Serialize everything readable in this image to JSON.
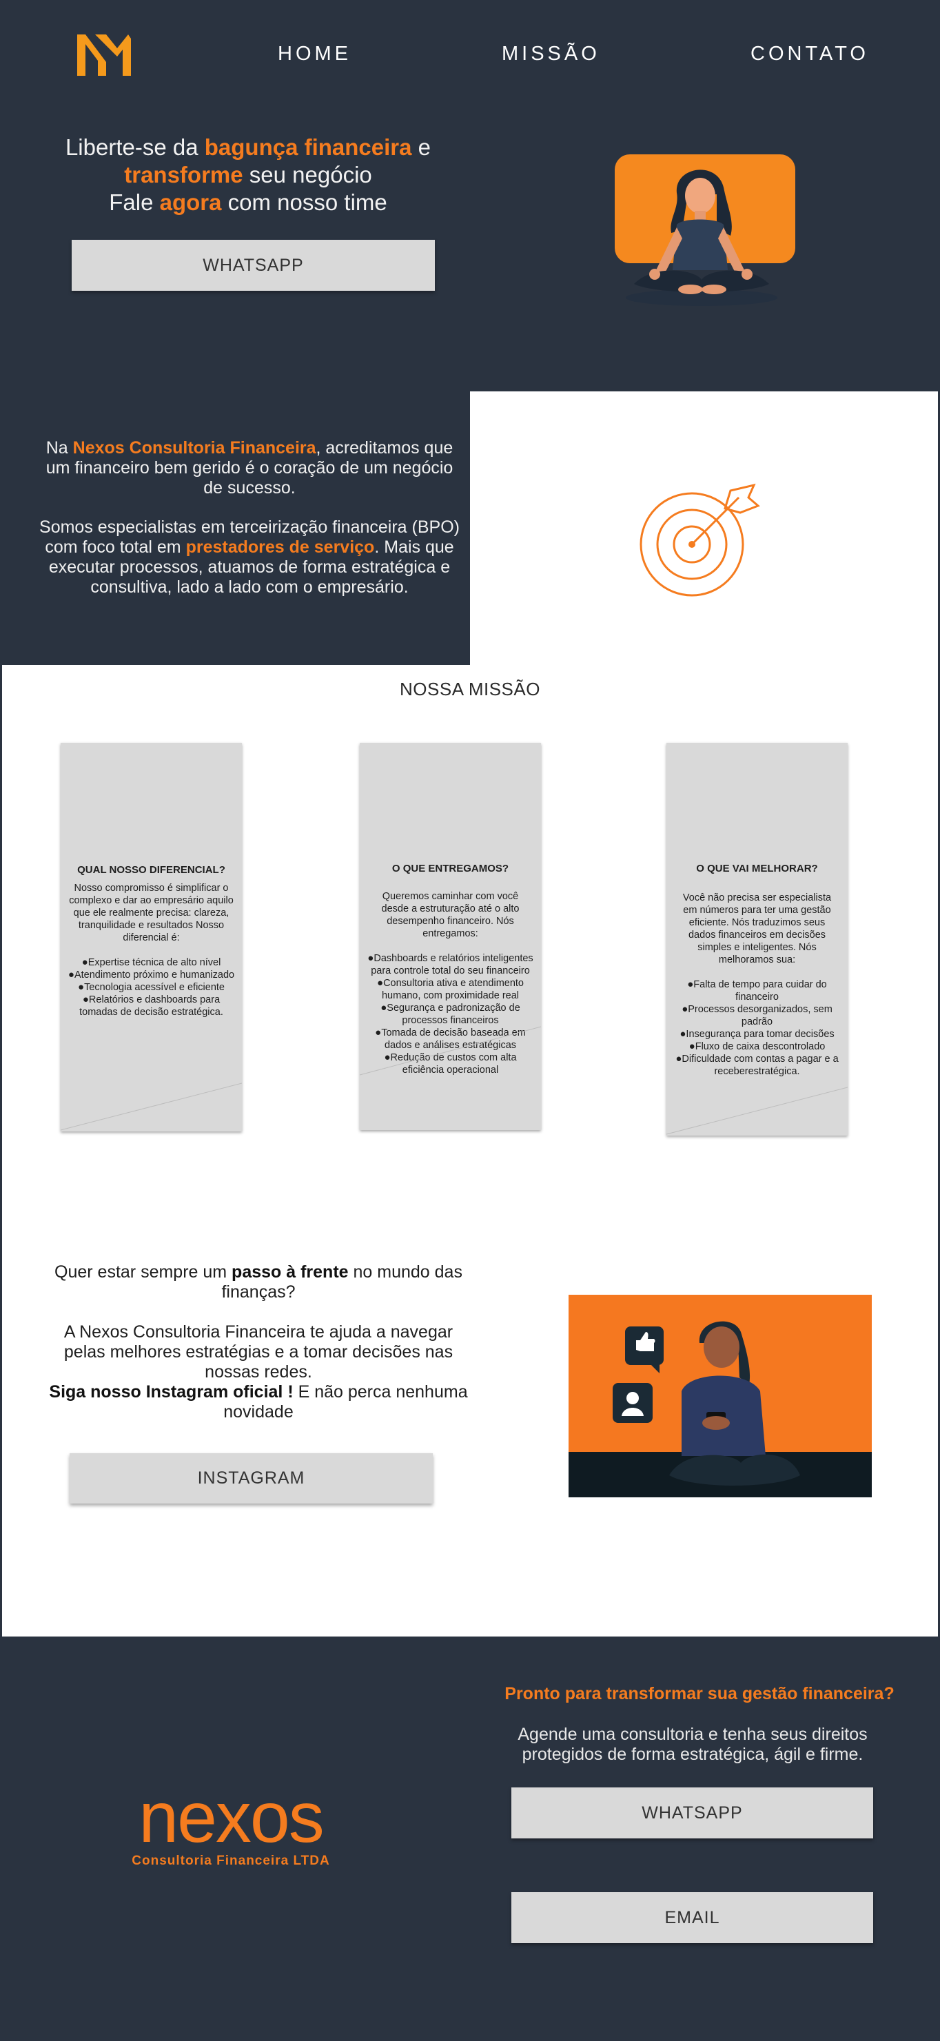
{
  "header": {
    "nav": [
      "HOME",
      "MISSÃO",
      "CONTATO"
    ]
  },
  "hero": {
    "line1_a": "Liberte-se da ",
    "line1_b": "bagunça financeira",
    "line1_c": " e",
    "line2_a": "transforme",
    "line2_b": " seu negócio",
    "line3_a": "Fale ",
    "line3_b": "agora",
    "line3_c": " com nosso time",
    "button": "WHATSAPP"
  },
  "about": {
    "p1_a": "Na ",
    "p1_b": "Nexos Consultoria Financeira",
    "p1_c": ", acreditamos que um financeiro bem gerido é o coração de um negócio de sucesso.",
    "p2_a": "Somos especialistas em terceirização financeira (BPO) com foco total em ",
    "p2_b": "prestadores de serviço",
    "p2_c": ". Mais que executar processos, atuamos de forma estratégica e consultiva, lado a lado com o empresário."
  },
  "mission": {
    "title": "NOSSA MISSÃO",
    "cards": [
      {
        "title": "QUAL NOSSO DIFERENCIAL?",
        "body": "Nosso compromisso é simplificar o complexo e dar ao empresário aquilo que ele realmente precisa: clareza, tranquilidade e resultados Nosso diferencial é:",
        "items": [
          "Expertise técnica de alto nível",
          "Atendimento próximo e humanizado",
          "Tecnologia acessível e eficiente",
          "Relatórios e dashboards para tomadas de decisão estratégica."
        ]
      },
      {
        "title": "O QUE ENTREGAMOS?",
        "body": "Queremos caminhar com você desde a estruturação até o alto desempenho financeiro. Nós entregamos:",
        "items": [
          "Dashboards e relatórios inteligentes para controle total do seu financeiro",
          "Consultoria ativa e atendimento humano, com proximidade real",
          "Segurança e padronização de processos financeiros",
          "Tomada de decisão baseada em dados e análises estratégicas",
          "Redução de custos com alta eficiência operacional"
        ]
      },
      {
        "title": "O QUE VAI MELHORAR?",
        "body": "Você não precisa ser especialista em números para ter uma gestão eficiente. Nós traduzimos seus dados financeiros em decisões simples e inteligentes. Nós melhoramos sua:",
        "items": [
          "Falta de tempo para cuidar do financeiro",
          "Processos desorganizados, sem padrão",
          "Insegurança para tomar decisões",
          "Fluxo de caixa descontrolado",
          "Dificuldade com contas a pagar e a receberestratégica."
        ]
      }
    ]
  },
  "instagram": {
    "p1_a": "Quer estar sempre um ",
    "p1_b": "passo à frente",
    "p1_c": " no mundo das finanças?",
    "p2": "A Nexos Consultoria Financeira te ajuda a navegar pelas melhores estratégias e a tomar decisões nas nossas redes.",
    "p3_a": "Siga nosso Instagram oficial !",
    "p3_b": " E não perca nenhuma novidade",
    "button": "INSTAGRAM"
  },
  "footer": {
    "logo_word": "nexos",
    "logo_sub": "Consultoria Financeira LTDA",
    "question": "Pronto para transformar sua gestão financeira?",
    "sub": "Agende uma consultoria e tenha seus direitos protegidos de forma estratégica, ágil e firme.",
    "button_whatsapp": "WHATSAPP",
    "button_email": "EMAIL"
  },
  "colors": {
    "navy": "#2a3340",
    "orange": "#f57c1f",
    "card_gray": "#d9d9d9",
    "white": "#ffffff"
  }
}
